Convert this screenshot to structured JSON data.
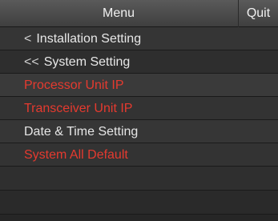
{
  "header": {
    "title": "Menu",
    "quit_label": "Quit"
  },
  "menu": {
    "items": [
      {
        "label": "Installation Setting",
        "icon": "chevron-left-icon",
        "glyph": "<"
      },
      {
        "label": "System Setting",
        "icon": "double-chevron-left-icon",
        "glyph": "<<"
      },
      {
        "label": "Processor Unit IP"
      },
      {
        "label": "Transceiver Unit IP"
      },
      {
        "label": "Date & Time Setting"
      },
      {
        "label": "System All Default"
      }
    ]
  },
  "colors": {
    "highlight_text": "#e53a2f",
    "normal_text": "#e6e6e6",
    "background": "#262626"
  }
}
